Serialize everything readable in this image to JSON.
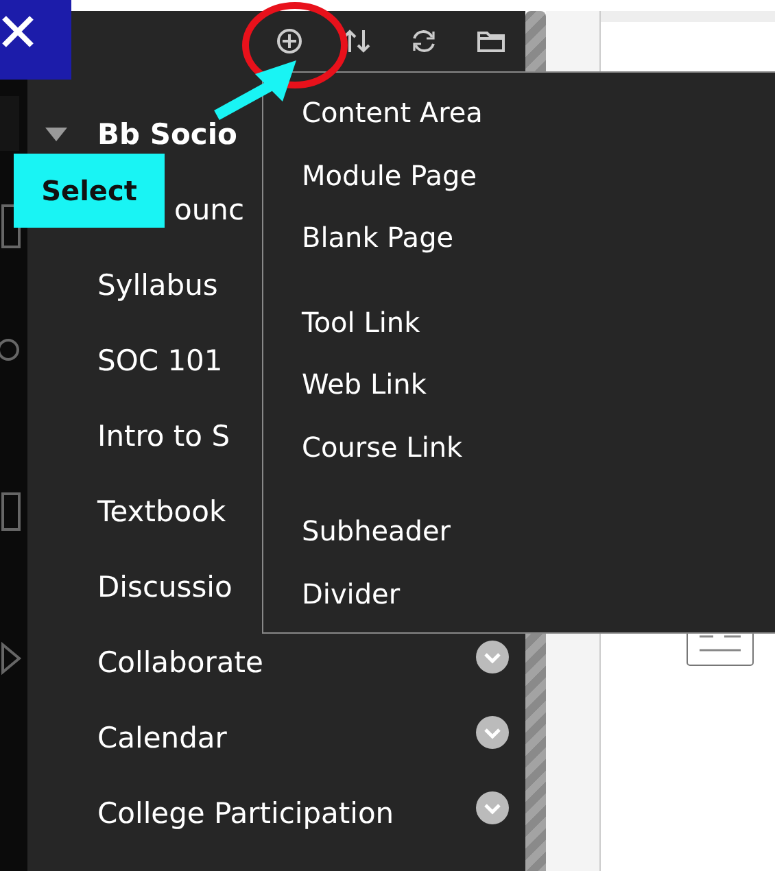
{
  "sidebar": {
    "items": [
      {
        "label": "Bb Socio",
        "kind": "header",
        "expanded": true,
        "has_menu": false
      },
      {
        "label": "ounc",
        "kind": "covered",
        "has_menu": false
      },
      {
        "label": "Syllabus",
        "kind": "link",
        "has_menu": false
      },
      {
        "label": "SOC 101",
        "kind": "link",
        "has_menu": false
      },
      {
        "label": "Intro to S",
        "kind": "link",
        "has_menu": false
      },
      {
        "label": "Textbook",
        "kind": "link",
        "has_menu": false
      },
      {
        "label": "Discussio",
        "kind": "link",
        "has_menu": false
      },
      {
        "label": "Collaborate",
        "kind": "link",
        "has_menu": true
      },
      {
        "label": "Calendar",
        "kind": "link",
        "has_menu": true
      },
      {
        "label": "College Participation",
        "kind": "link",
        "has_menu": true
      }
    ]
  },
  "add_menu": {
    "groups": [
      [
        "Content Area",
        "Module Page",
        "Blank Page"
      ],
      [
        "Tool Link",
        "Web Link",
        "Course Link"
      ],
      [
        "Subheader",
        "Divider"
      ]
    ]
  },
  "annotation": {
    "label": "Select"
  }
}
